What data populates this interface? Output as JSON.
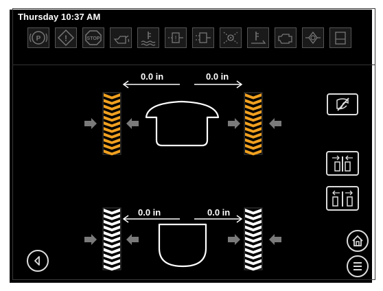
{
  "status_bar": {
    "datetime": "Thursday 10:37 AM"
  },
  "warning_icons": [
    {
      "name": "parking-brake-icon",
      "text": "(P)"
    },
    {
      "name": "general-warning-icon",
      "text": "!"
    },
    {
      "name": "stop-icon",
      "text": "STOP"
    },
    {
      "name": "oil-pressure-icon",
      "text": ""
    },
    {
      "name": "coolant-temperature-icon",
      "text": ""
    },
    {
      "name": "hydraulic-filter-icon",
      "text": ""
    },
    {
      "name": "transmission-filter-icon",
      "text": ""
    },
    {
      "name": "fuel-filter-icon",
      "text": ""
    },
    {
      "name": "hydraulic-temperature-icon",
      "text": ""
    },
    {
      "name": "engine-icon",
      "text": ""
    },
    {
      "name": "engine-warning-icon",
      "text": ""
    },
    {
      "name": "fuel-level-icon",
      "text": ""
    }
  ],
  "front_axle": {
    "left_measure": "0.0 in",
    "right_measure": "0.0 in"
  },
  "rear_axle": {
    "left_measure": "0.0 in",
    "right_measure": "0.0 in"
  },
  "colors": {
    "background": "#000000",
    "front_tire": "#f0a020",
    "rear_tire": "#ffffff",
    "arrow": "#7a7a7a"
  }
}
